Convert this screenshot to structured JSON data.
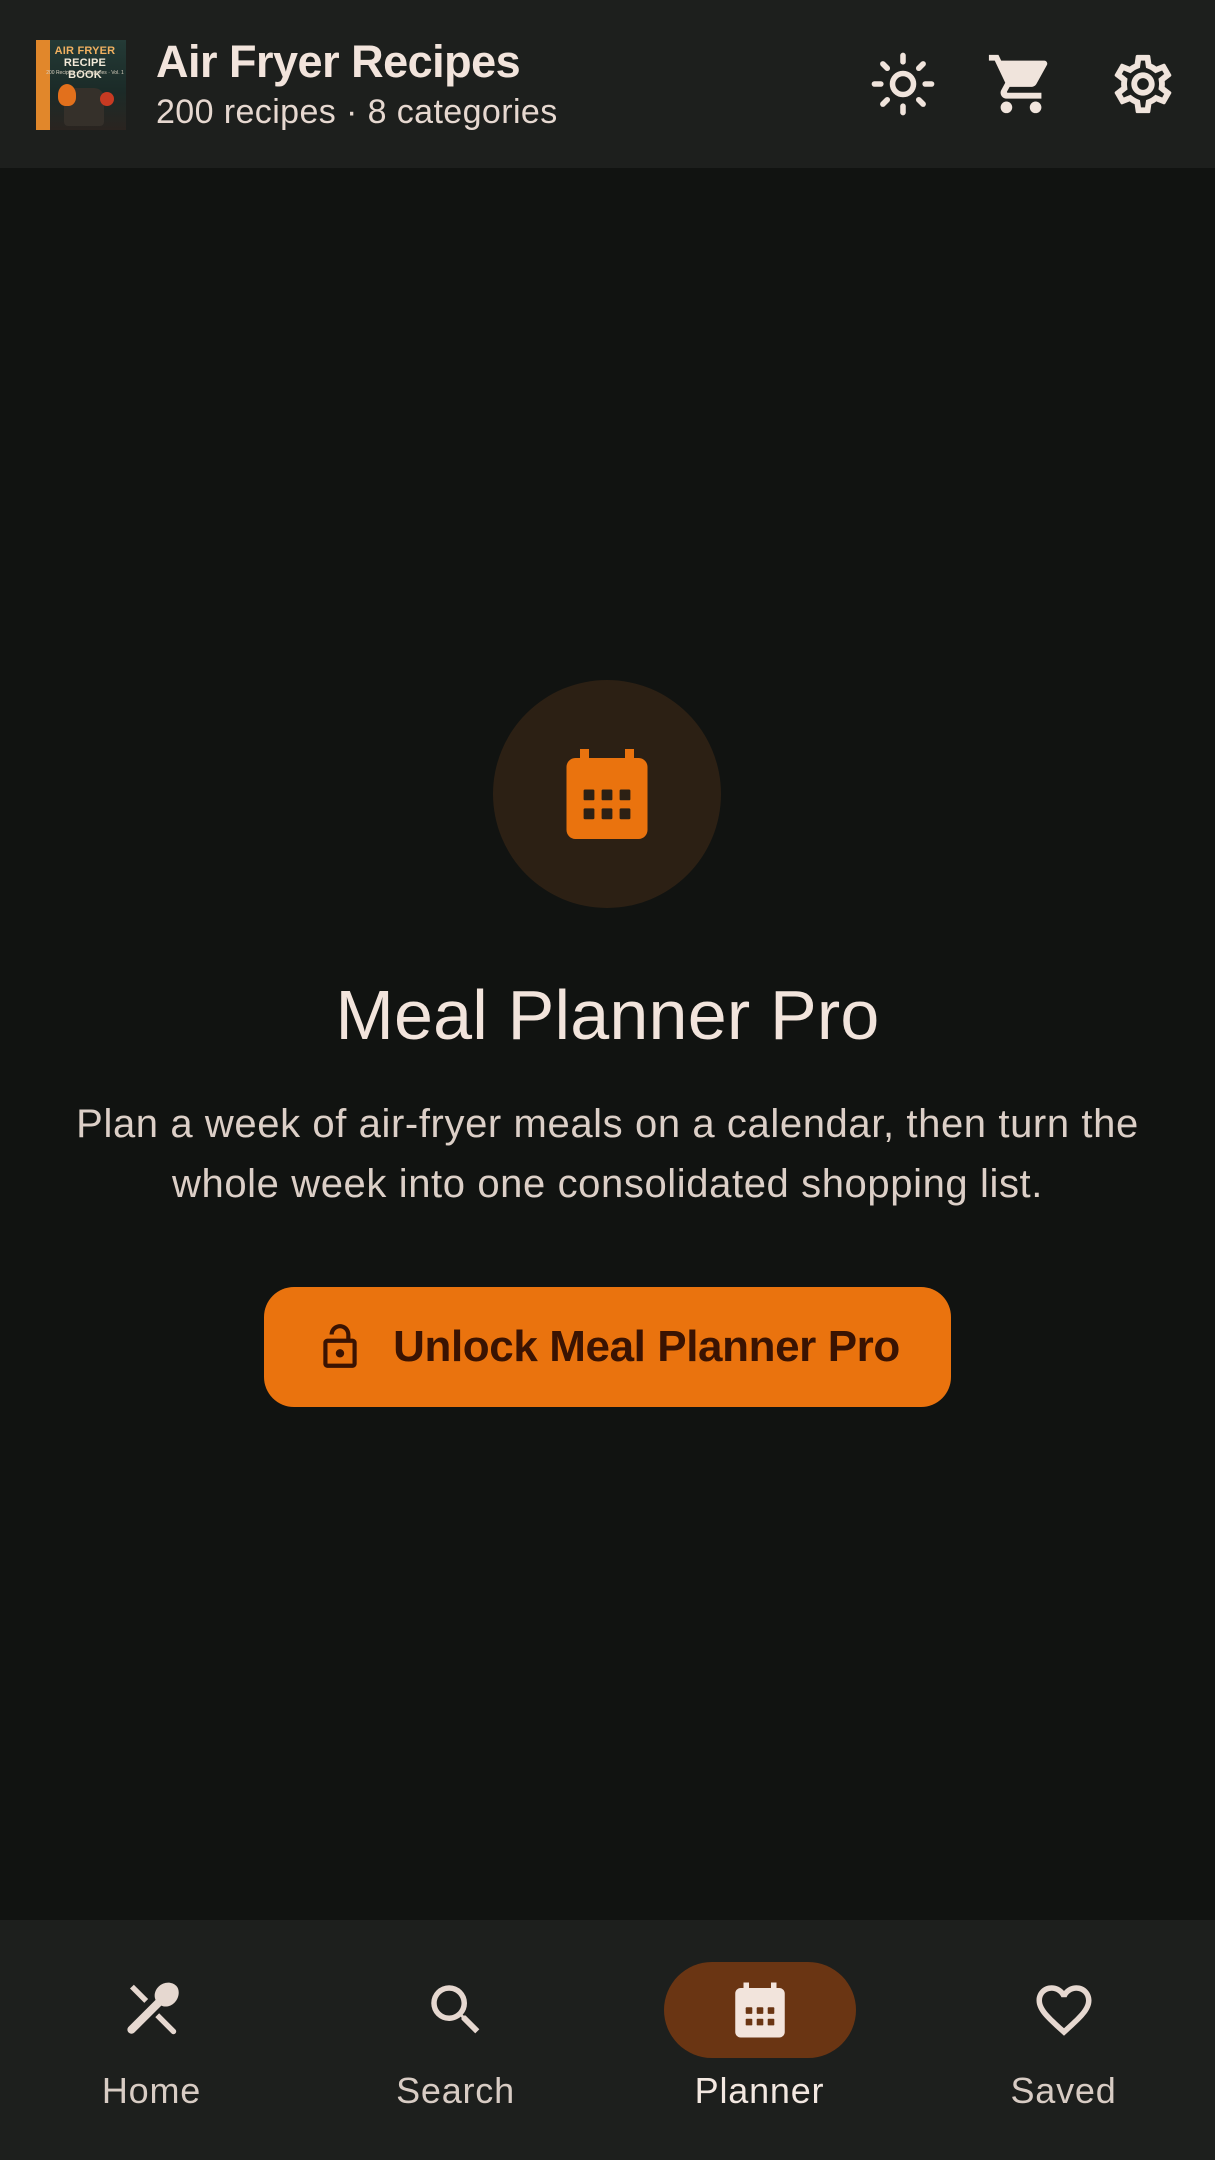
{
  "header": {
    "cover": {
      "line1": "AIR FRYER",
      "line2": "RECIPE BOOK",
      "subline": "200 Recipes · 8 Categories · Vol. 1"
    },
    "title": "Air Fryer Recipes",
    "subtitle": "200 recipes · 8 categories",
    "actions": [
      {
        "icon": "sun-icon",
        "label": "theme"
      },
      {
        "icon": "cart-icon",
        "label": "shopping list"
      },
      {
        "icon": "gear-icon",
        "label": "settings"
      }
    ]
  },
  "main": {
    "icon": "calendar-icon",
    "title": "Meal Planner Pro",
    "description": "Plan a week of air-fryer meals on a calendar, then turn the whole week into one consolidated shopping list.",
    "unlock_button": {
      "icon": "lock-icon",
      "label": "Unlock Meal Planner Pro"
    }
  },
  "nav": {
    "items": [
      {
        "label": "Home",
        "icon": "fork-spoon-icon",
        "active": false
      },
      {
        "label": "Search",
        "icon": "search-icon",
        "active": false
      },
      {
        "label": "Planner",
        "icon": "calendar-icon",
        "active": true
      },
      {
        "label": "Saved",
        "icon": "heart-icon",
        "active": false
      }
    ]
  },
  "colors": {
    "background": "#111311",
    "surface": "#1d1f1d",
    "accent": "#ea730e",
    "accent_container": "#6a3513",
    "icon_circle": "#2c2014",
    "on_surface": "#f2e4dc"
  }
}
